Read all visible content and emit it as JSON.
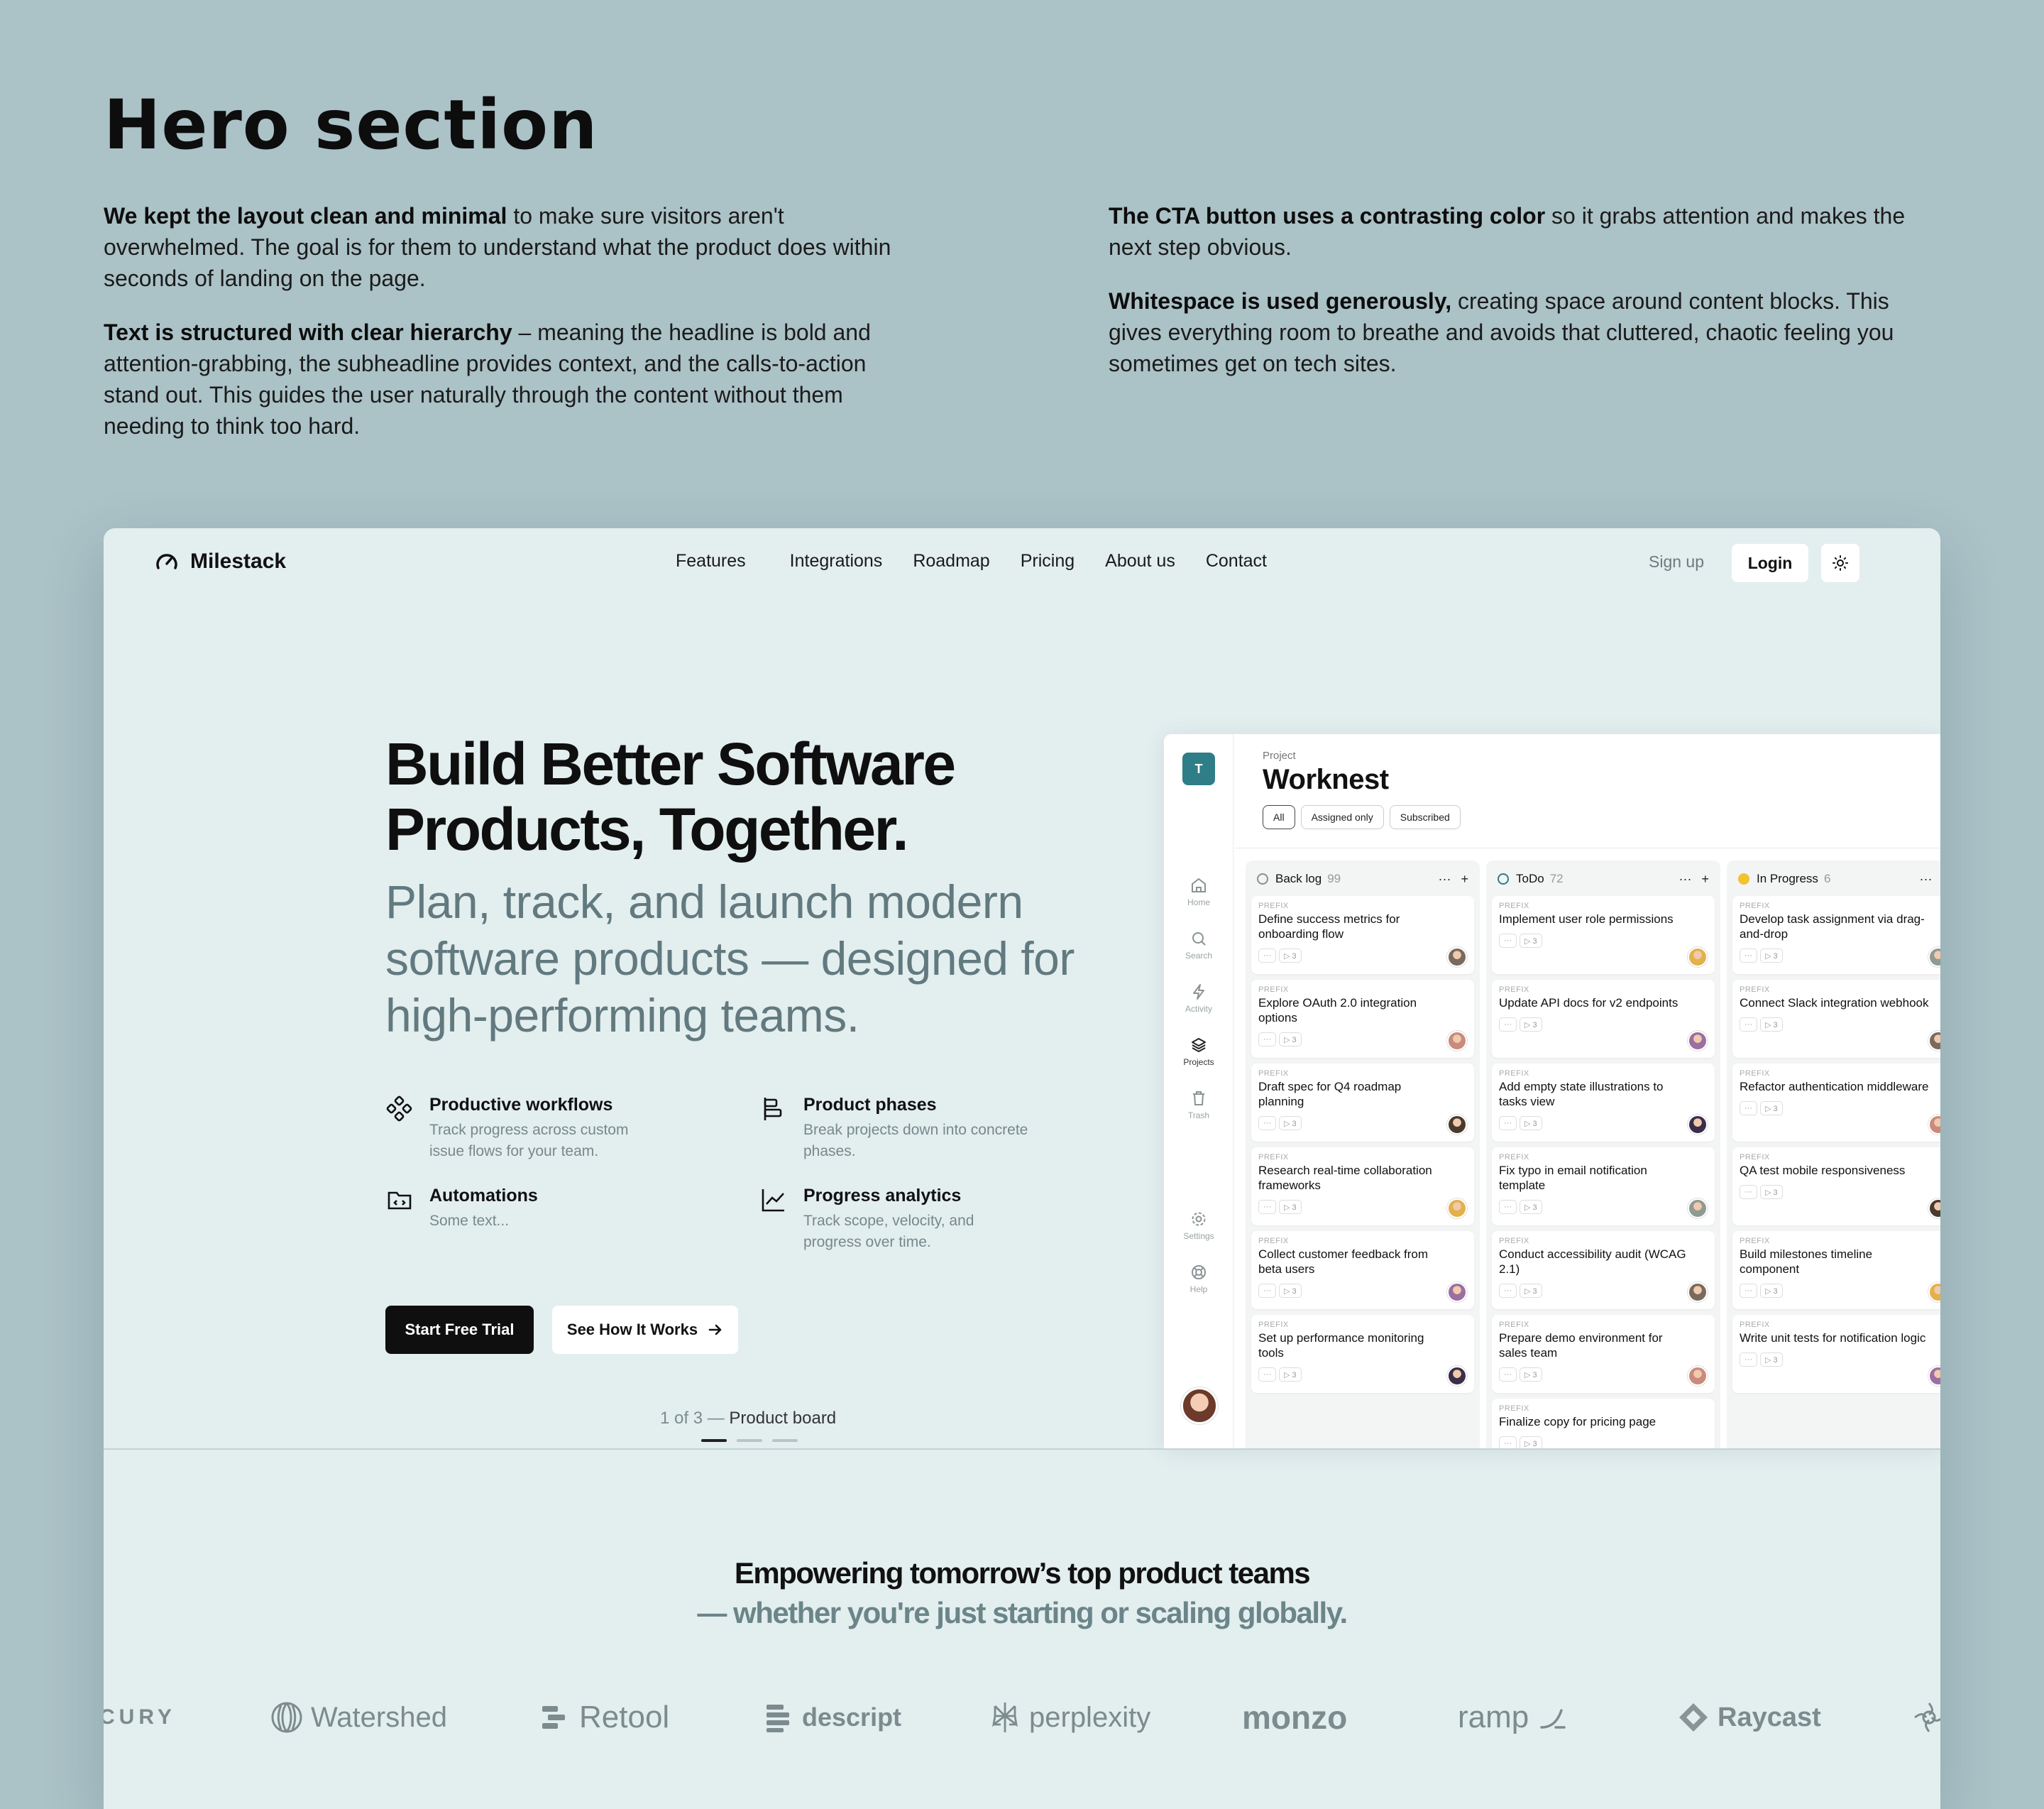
{
  "annotation": {
    "title": "Hero section",
    "left_paragraphs": [
      {
        "bold": "We kept the layout clean and minimal",
        "rest": " to make sure visitors aren't overwhelmed. The goal is for them to understand what the product does within seconds of landing on the page."
      },
      {
        "bold": "Text is structured with clear hierarchy",
        "rest": " – meaning the headline is bold and attention-grabbing, the subheadline provides context, and the calls-to-action stand out. This guides the user naturally through the content without them needing to think too hard."
      }
    ],
    "right_paragraphs": [
      {
        "bold": "The CTA button uses a contrasting color",
        "rest": " so it grabs attention and makes the next step obvious."
      },
      {
        "bold": "Whitespace is used generously,",
        "rest": " creating space around content blocks. This gives everything room to breathe and avoids that cluttered, chaotic feeling you sometimes get on tech sites."
      }
    ]
  },
  "nav": {
    "brand": "Milestack",
    "links": [
      "Features",
      "Integrations",
      "Roadmap",
      "Pricing",
      "About us",
      "Contact"
    ],
    "signup": "Sign up",
    "login": "Login",
    "theme_icon": "sun-icon"
  },
  "hero": {
    "headline": "Build Better Software Products, Together.",
    "subheadline": "Plan, track, and launch modern software products — designed for high-performing teams.",
    "features": [
      {
        "icon": "workflow-icon",
        "title": "Productive workflows",
        "desc": "Track progress across custom issue flows for your team."
      },
      {
        "icon": "phases-icon",
        "title": "Product phases",
        "desc": "Break projects down into concrete phases."
      },
      {
        "icon": "automation-icon",
        "title": "Automations",
        "desc": "Some text..."
      },
      {
        "icon": "analytics-icon",
        "title": "Progress analytics",
        "desc": "Track scope, velocity, and progress over time."
      }
    ],
    "primary_cta": "Start Free Trial",
    "secondary_cta": "See How It Works",
    "pager": {
      "position": "1 of 3 —",
      "label": "Product board"
    }
  },
  "app": {
    "logo": "T",
    "sidebar": [
      {
        "icon": "home-icon",
        "label": "Home"
      },
      {
        "icon": "search-icon",
        "label": "Search"
      },
      {
        "icon": "activity-icon",
        "label": "Activity"
      },
      {
        "icon": "projects-icon",
        "label": "Projects"
      },
      {
        "icon": "trash-icon",
        "label": "Trash"
      },
      {
        "icon": "settings-icon",
        "label": "Settings"
      },
      {
        "icon": "help-icon",
        "label": "Help"
      }
    ],
    "project_label": "Project",
    "project_title": "Worknest",
    "filters": [
      "All",
      "Assigned only",
      "Subscribed"
    ],
    "task_prefix": "PREFIX",
    "meta_more": "···",
    "meta_sub": "▷ 3",
    "columns": [
      {
        "name": "Back log",
        "count": "99",
        "color": "#8a8f91",
        "tasks": [
          "Define success metrics for onboarding flow",
          "Explore OAuth 2.0 integration options",
          "Draft spec for Q4 roadmap planning",
          "Research real-time collaboration frameworks",
          "Collect customer feedback from beta users",
          "Set up performance monitoring tools"
        ]
      },
      {
        "name": "ToDo",
        "count": "72",
        "color": "#2f7d87",
        "tasks": [
          "Implement user role permissions",
          "Update API docs for v2 endpoints",
          "Add empty state illustrations to tasks view",
          "Fix typo in email notification template",
          "Conduct accessibility audit (WCAG 2.1)",
          "Prepare demo environment for sales team",
          "Finalize copy for pricing page"
        ]
      },
      {
        "name": "In Progress",
        "count": "6",
        "color": "#f2c230",
        "tasks": [
          "Develop task assignment via drag-and-drop",
          "Connect Slack integration webhook",
          "Refactor authentication middleware",
          "QA test mobile responsiveness",
          "Build milestones timeline component",
          "Write unit tests for notification logic"
        ]
      }
    ]
  },
  "logos_section": {
    "tagline_1": "Empowering tomorrow’s top product teams",
    "tagline_2": "— whether you're just starting or scaling globally.",
    "brands": [
      "CURY",
      "Watershed",
      "Retool",
      "descript",
      "perplexity",
      "monzo",
      "ramp",
      "Raycast"
    ]
  },
  "colors": {
    "page_bg": "#abc2c7",
    "card_bg": "#e3eeef",
    "accent": "#2f7d87",
    "subhead": "#627a7f"
  }
}
